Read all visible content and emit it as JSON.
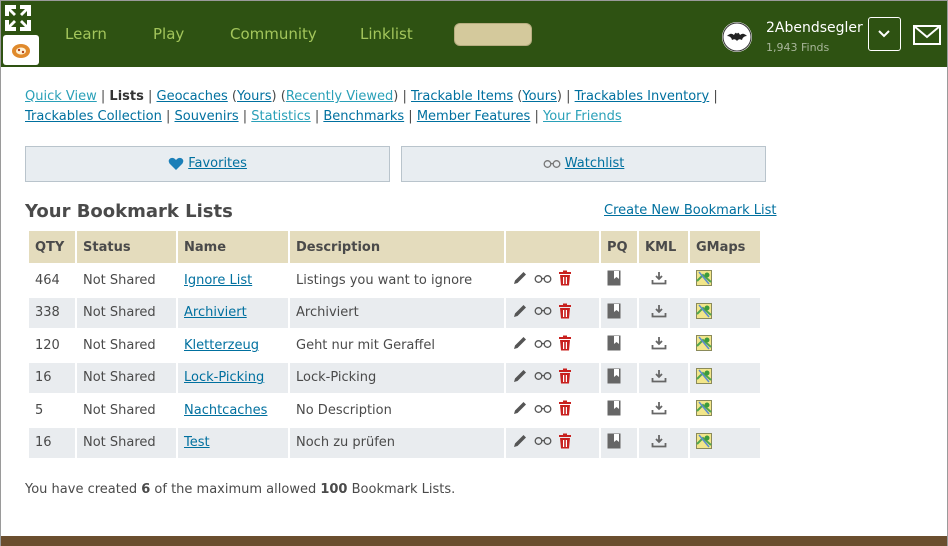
{
  "header": {
    "nav": [
      "Learn",
      "Play",
      "Community",
      "Linklist"
    ],
    "username": "2Abendsegler",
    "finds": "1,943 Finds"
  },
  "subnav": {
    "quick_view": "Quick View",
    "lists": "Lists",
    "geocaches": "Geocaches",
    "yours1": "Yours",
    "recently_viewed": "Recently Viewed",
    "trackable_items": "Trackable Items",
    "yours2": "Yours",
    "trackables_inventory": "Trackables Inventory",
    "trackables_collection": "Trackables Collection",
    "souvenirs": "Souvenirs",
    "statistics": "Statistics",
    "benchmarks": "Benchmarks",
    "member_features": "Member Features",
    "your_friends": "Your Friends"
  },
  "favorites_label": "Favorites",
  "watchlist_label": "Watchlist",
  "section_title": "Your Bookmark Lists",
  "create_link": "Create New Bookmark List",
  "table": {
    "headers": [
      "QTY",
      "Status",
      "Name",
      "Description",
      "",
      "PQ",
      "KML",
      "GMaps"
    ],
    "rows": [
      {
        "qty": "464",
        "status": "Not Shared",
        "name": "Ignore List",
        "desc": "Listings you want to ignore"
      },
      {
        "qty": "338",
        "status": "Not Shared",
        "name": "Archiviert",
        "desc": "Archiviert"
      },
      {
        "qty": "120",
        "status": "Not Shared",
        "name": "Kletterzeug",
        "desc": "Geht nur mit Geraffel"
      },
      {
        "qty": "16",
        "status": "Not Shared",
        "name": "Lock-Picking",
        "desc": "Lock-Picking"
      },
      {
        "qty": "5",
        "status": "Not Shared",
        "name": "Nachtcaches",
        "desc": "No Description"
      },
      {
        "qty": "16",
        "status": "Not Shared",
        "name": "Test",
        "desc": "Noch zu prüfen"
      }
    ]
  },
  "footer": {
    "prefix": "You have created ",
    "count": "6",
    "middle": " of the maximum allowed ",
    "max": "100",
    "suffix": " Bookmark Lists."
  },
  "colors": {
    "header_bg": "#2e5212",
    "nav_text": "#a3c55b",
    "link": "#00709f",
    "table_header": "#e4dcbd",
    "delete_red": "#c8201e"
  },
  "icons": {
    "edit": "pencil-icon",
    "watch": "glasses-icon",
    "delete": "trash-icon",
    "pq": "bookmark-icon",
    "kml": "download-icon",
    "gmaps": "map-icon"
  }
}
